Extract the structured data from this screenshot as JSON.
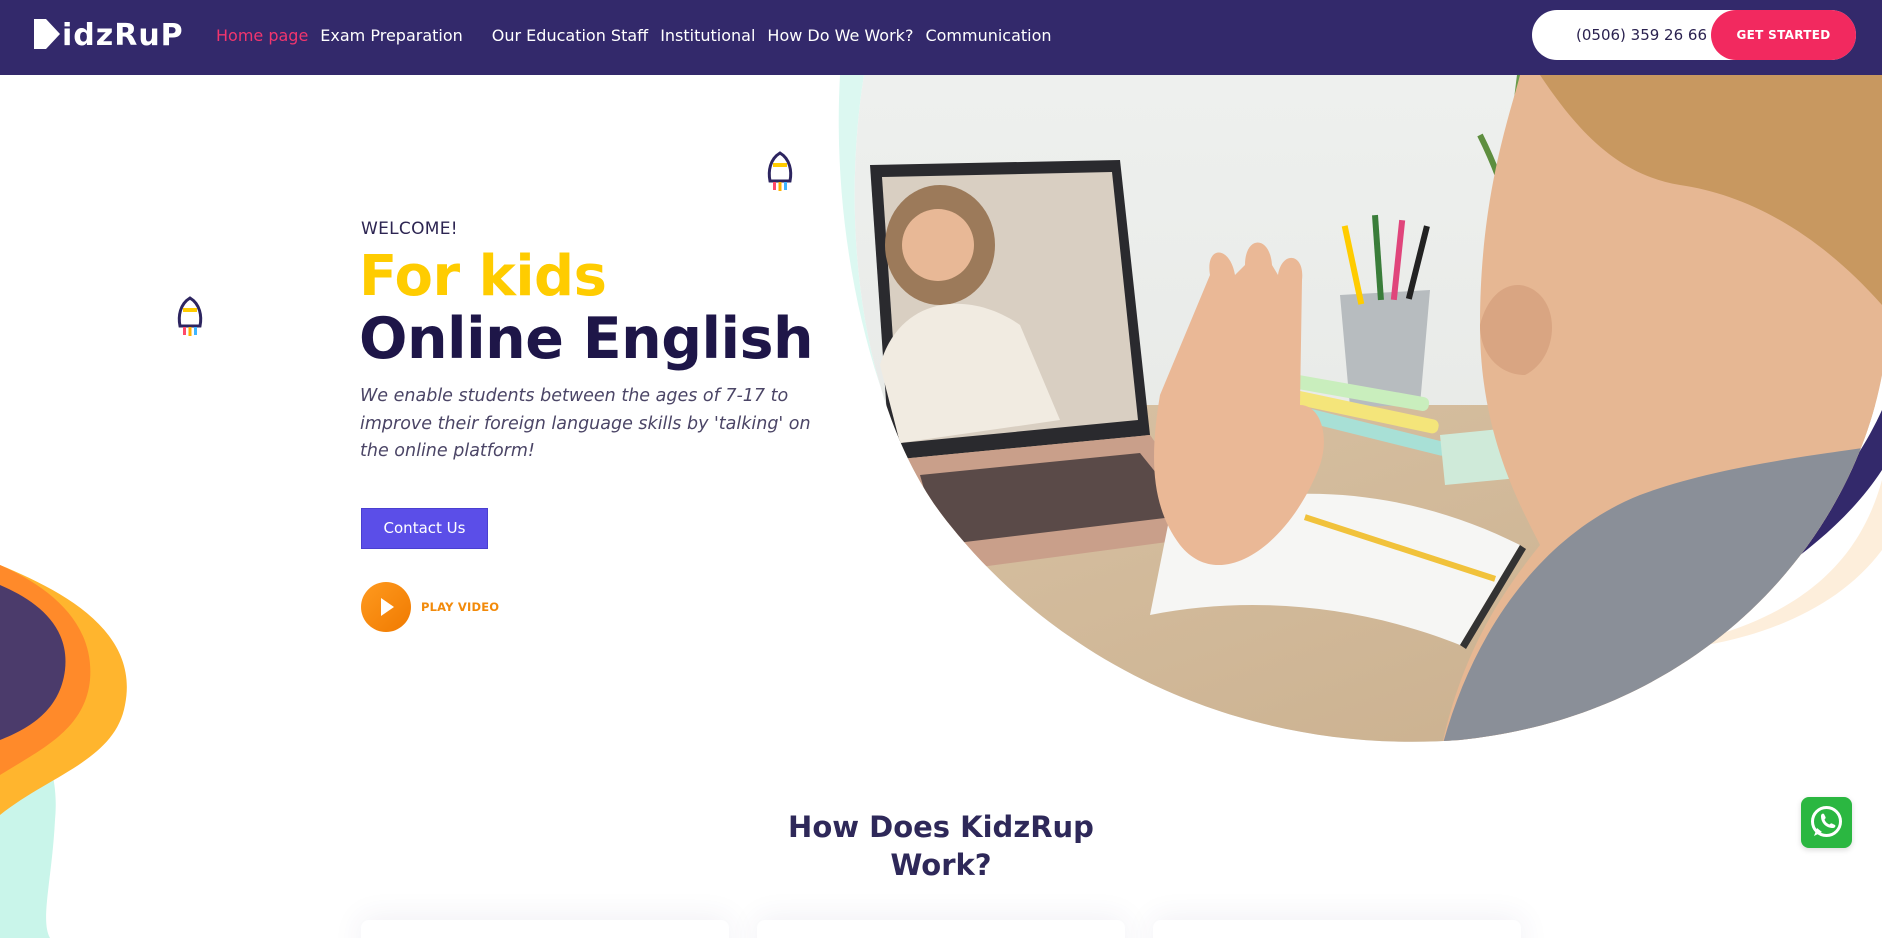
{
  "header": {
    "logo_text": "idzRuP",
    "nav": [
      {
        "label": "Home page",
        "active": true
      },
      {
        "label": "Exam Preparation",
        "active": false
      },
      {
        "label": "Our Education Staff",
        "active": false
      },
      {
        "label": "Institutional",
        "active": false
      },
      {
        "label": "How Do We Work?",
        "active": false
      },
      {
        "label": "Communication",
        "active": false
      }
    ],
    "phone": "(0506) 359 26 66",
    "cta_label": "GET STARTED"
  },
  "hero": {
    "eyebrow": "WELCOME!",
    "title_line1": "For kids",
    "title_line2": "Online English",
    "description": "We enable students between the ages of 7-17 to improve their foreign language skills by 'talking' on the online platform!",
    "contact_label": "Contact Us",
    "play_label": "PLAY VIDEO"
  },
  "how_it_works": {
    "title": "How Does KidzRup Work?"
  },
  "colors": {
    "nav_bg": "#33296b",
    "accent_pink": "#f2295f",
    "title_yellow": "#ffcc00",
    "title_dark": "#1e1648",
    "button_purple": "#5b4ee8",
    "play_orange": "#f28a0a",
    "whatsapp_green": "#2bb741"
  },
  "icons": {
    "play": "play-icon",
    "whatsapp": "whatsapp-icon",
    "rocket": "rocket-icon"
  }
}
